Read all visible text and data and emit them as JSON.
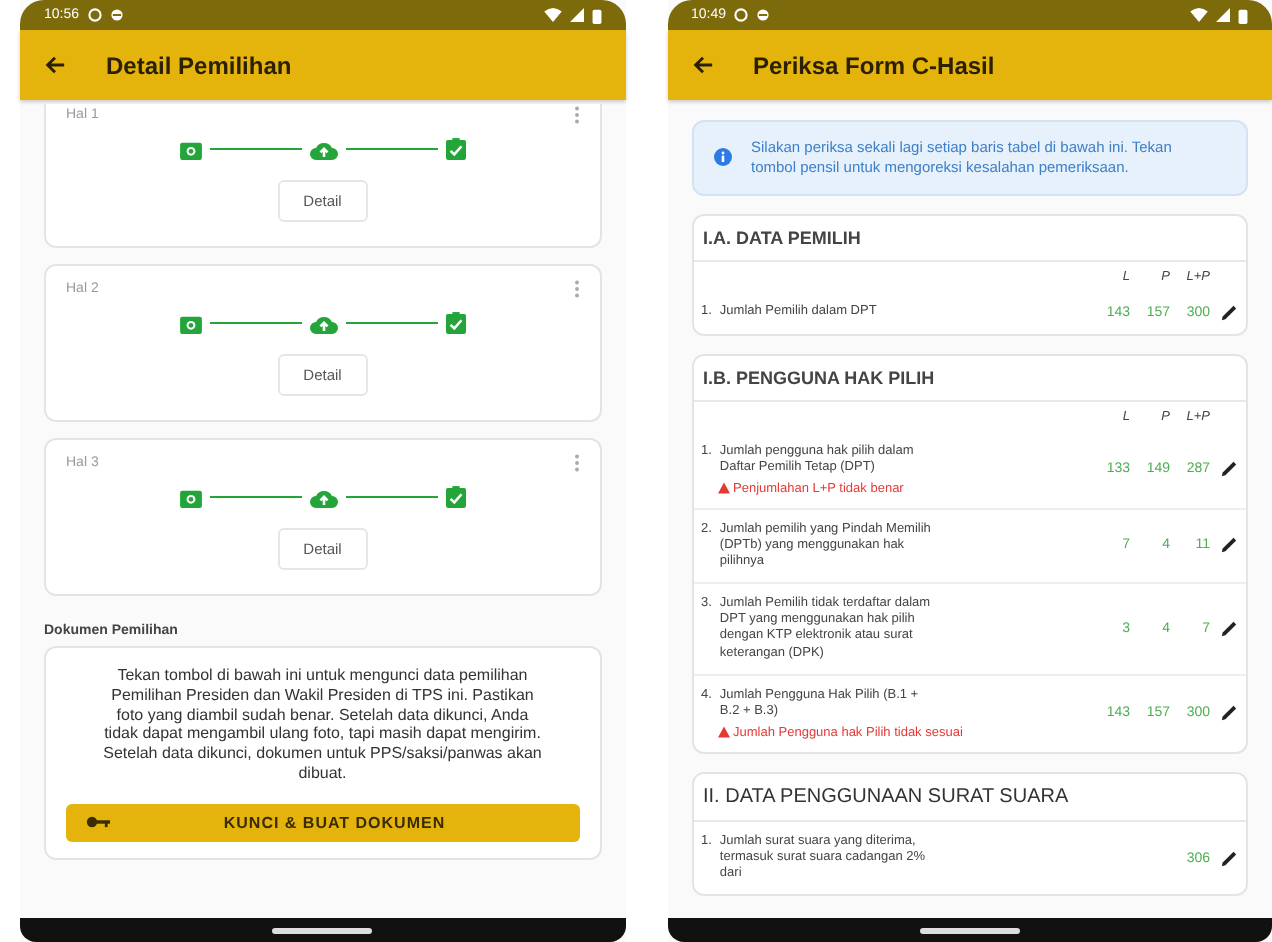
{
  "left_screen": {
    "status_bar": {
      "time": "10:56"
    },
    "app_bar": {
      "title": "Detail Pemilihan"
    },
    "pages": [
      {
        "label": "Hal 1",
        "button": "Detail",
        "steps": [
          {
            "kind": "camera",
            "done": true
          },
          {
            "kind": "upload",
            "done": true
          },
          {
            "kind": "check",
            "done": true
          }
        ]
      },
      {
        "label": "Hal 2",
        "button": "Detail",
        "steps": [
          {
            "kind": "camera",
            "done": true
          },
          {
            "kind": "upload",
            "done": true
          },
          {
            "kind": "check",
            "done": true
          }
        ]
      },
      {
        "label": "Hal 3",
        "button": "Detail",
        "steps": [
          {
            "kind": "camera",
            "done": true
          },
          {
            "kind": "upload",
            "done": true
          },
          {
            "kind": "check",
            "done": true
          }
        ]
      }
    ],
    "documents": {
      "heading": "Dokumen Pemilihan",
      "text": "Tekan tombol di bawah ini untuk mengunci data pemilihan Pemilihan Presiden dan Wakil Presiden di TPS ini. Pastikan foto yang diambil sudah benar. Setelah data dikunci, Anda tidak dapat mengambil ulang foto, tapi masih dapat mengirim. Setelah data dikunci, dokumen untuk PPS/saksi/panwas akan dibuat.",
      "button": "KUNCI & BUAT DOKUMEN"
    }
  },
  "right_screen": {
    "status_bar": {
      "time": "10:49"
    },
    "app_bar": {
      "title": "Periksa Form C-Hasil"
    },
    "info": "Silakan periksa sekali lagi setiap baris tabel di bawah ini. Tekan tombol pensil untuk mengoreksi kesalahan pemeriksaan.",
    "sections": [
      {
        "title": "I.A. DATA PEMILIH",
        "columns": [
          "L",
          "P",
          "L+P"
        ],
        "rows": [
          {
            "number": "1.",
            "label": "Jumlah Pemilih dalam DPT",
            "l": "143",
            "p": "157",
            "lp": "300"
          }
        ]
      },
      {
        "title": "I.B. PENGGUNA HAK PILIH",
        "columns": [
          "L",
          "P",
          "L+P"
        ],
        "rows": [
          {
            "number": "1.",
            "label": "Jumlah pengguna hak pilih dalam Daftar Pemilih Tetap (DPT)",
            "l": "133",
            "p": "149",
            "lp": "287",
            "warning": "Penjumlahan L+P tidak benar"
          },
          {
            "number": "2.",
            "label": "Jumlah pemilih yang Pindah Memilih (DPTb) yang menggunakan hak pilihnya",
            "l": "7",
            "p": "4",
            "lp": "11"
          },
          {
            "number": "3.",
            "label": "Jumlah Pemilih tidak terdaftar dalam DPT yang menggunakan hak pilih dengan KTP elektronik atau surat keterangan (DPK)",
            "l": "3",
            "p": "4",
            "lp": "7"
          },
          {
            "number": "4.",
            "label": "Jumlah Pengguna Hak Pilih (B.1 + B.2 + B.3)",
            "l": "143",
            "p": "157",
            "lp": "300",
            "warning": "Jumlah Pengguna hak Pilih tidak sesuai"
          }
        ]
      },
      {
        "title": "II. DATA PENGGUNAAN SURAT SUARA",
        "rows": [
          {
            "number": "1.",
            "label": "Jumlah surat suara yang diterima, termasuk surat suara cadangan 2% dari",
            "lp": "306"
          }
        ]
      }
    ]
  }
}
